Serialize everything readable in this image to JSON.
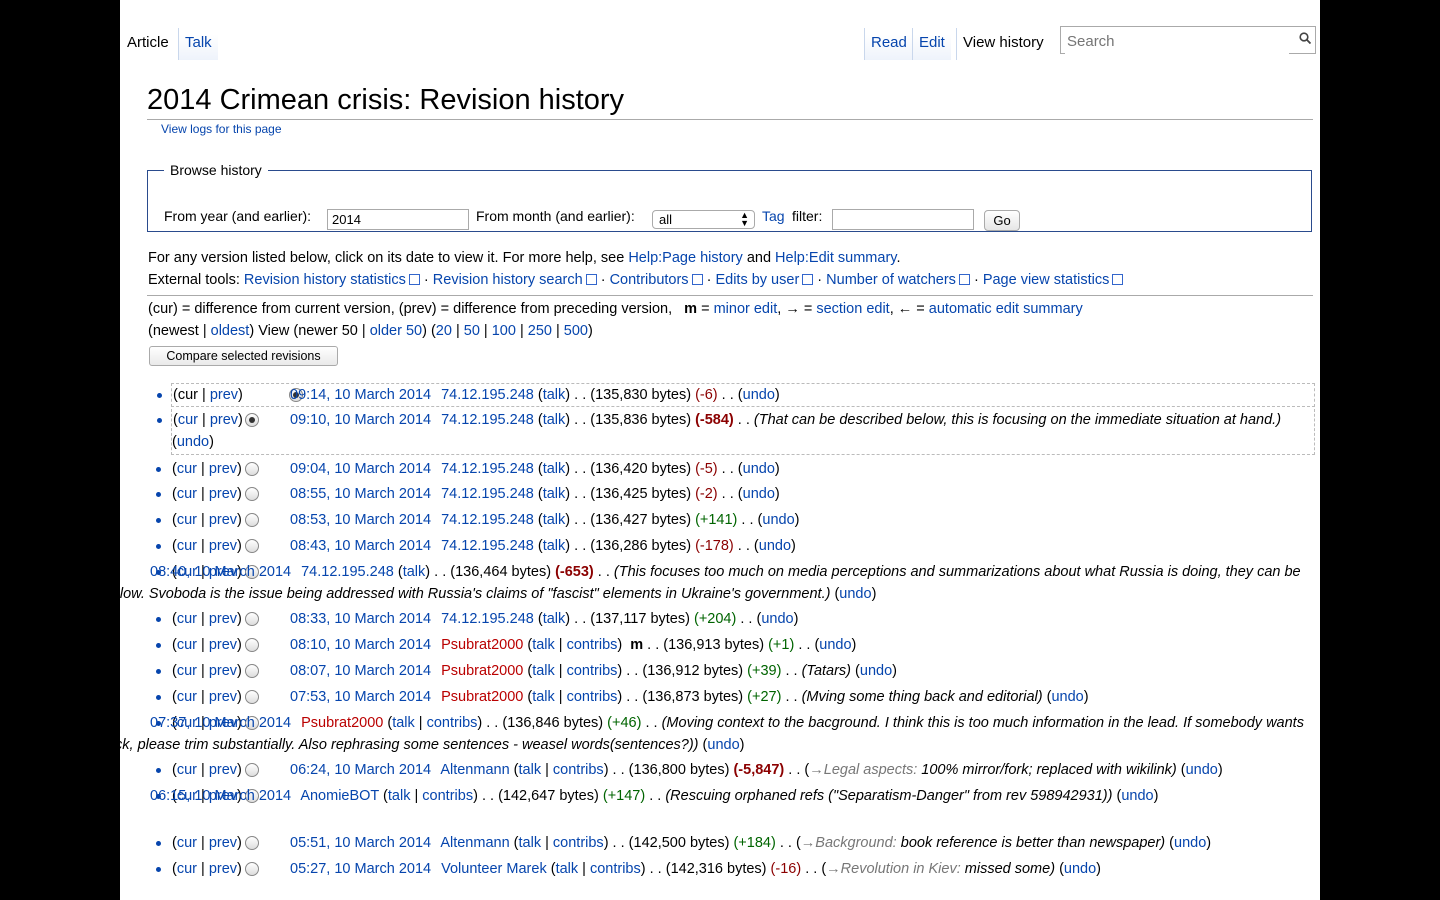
{
  "tabs": {
    "article": "Article",
    "talk": "Talk",
    "read": "Read",
    "edit": "Edit",
    "view_history": "View history"
  },
  "search": {
    "placeholder": "Search"
  },
  "title": "2014 Crimean crisis: Revision history",
  "view_logs": "View logs for this page",
  "browse": {
    "legend": "Browse history",
    "year_label": "From year (and earlier):",
    "year_value": "2014",
    "month_label": "From month (and earlier):",
    "month_value": "all",
    "tag_link": "Tag",
    "tag_label": "filter:",
    "go": "Go"
  },
  "help": {
    "prefix": "For any version listed below, click on its date to view it. For more help, see",
    "link1": "Help:Page history",
    "and": "and",
    "link2": "Help:Edit summary",
    "end": "."
  },
  "external": {
    "label": "External tools:",
    "tools": [
      "Revision history statistics",
      "Revision history search",
      "Contributors",
      "Edits by user",
      "Number of watchers",
      "Page view statistics"
    ]
  },
  "legend_line": {
    "cur": "(cur) = difference from current version, (prev) = difference from preceding version,",
    "m": "m",
    "minor": "minor edit",
    "arrow": "→",
    "eq": "=",
    "section": "section edit",
    "larrow": "←",
    "auto": "automatic edit summary"
  },
  "nav": {
    "newest": "newest",
    "oldest": "oldest",
    "view": "View (newer 50",
    "older": "older 50",
    "counts": [
      "20",
      "50",
      "100",
      "250",
      "500"
    ]
  },
  "compare_button": "Compare selected revisions",
  "revisions": [
    {
      "date": "09:14, 10 March 2014",
      "user": "74.12.195.248",
      "ip": true,
      "bytes": "(135,830 bytes)",
      "diff": "(-6)",
      "diff_class": "neg",
      "comment": "",
      "radio": "first"
    },
    {
      "date": "09:10, 10 March 2014",
      "user": "74.12.195.248",
      "ip": true,
      "bytes": "(135,836 bytes)",
      "diff": "(-584)",
      "diff_class": "negbig",
      "comment": "(That can be described below, this is focusing on the immediate situation at hand.)",
      "radio": "second"
    },
    {
      "date": "09:04, 10 March 2014",
      "user": "74.12.195.248",
      "ip": true,
      "bytes": "(136,420 bytes)",
      "diff": "(-5)",
      "diff_class": "neg",
      "comment": ""
    },
    {
      "date": "08:55, 10 March 2014",
      "user": "74.12.195.248",
      "ip": true,
      "bytes": "(136,425 bytes)",
      "diff": "(-2)",
      "diff_class": "neg",
      "comment": ""
    },
    {
      "date": "08:53, 10 March 2014",
      "user": "74.12.195.248",
      "ip": true,
      "bytes": "(136,427 bytes)",
      "diff": "(+141)",
      "diff_class": "pos",
      "comment": ""
    },
    {
      "date": "08:43, 10 March 2014",
      "user": "74.12.195.248",
      "ip": true,
      "bytes": "(136,286 bytes)",
      "diff": "(-178)",
      "diff_class": "neg",
      "comment": ""
    },
    {
      "date": "08:40, 10 March 2014",
      "user": "74.12.195.248",
      "ip": true,
      "bytes": "(136,464 bytes)",
      "diff": "(-653)",
      "diff_class": "negbig",
      "comment": "(This focuses too much on media perceptions and summarizations about what Russia is doing, they can be addressed below. Svoboda is the issue being addressed with Russia's claims of \"fascist\" elements in Ukraine's government.)"
    },
    {
      "date": "08:33, 10 March 2014",
      "user": "74.12.195.248",
      "ip": true,
      "bytes": "(137,117 bytes)",
      "diff": "(+204)",
      "diff_class": "pos",
      "comment": ""
    },
    {
      "date": "08:10, 10 March 2014",
      "user": "Psubrat2000",
      "red": true,
      "minor": true,
      "bytes": "(136,913 bytes)",
      "diff": "(+1)",
      "diff_class": "pos",
      "comment": ""
    },
    {
      "date": "08:07, 10 March 2014",
      "user": "Psubrat2000",
      "red": true,
      "bytes": "(136,912 bytes)",
      "diff": "(+39)",
      "diff_class": "pos",
      "comment": "(Tatars)"
    },
    {
      "date": "07:53, 10 March 2014",
      "user": "Psubrat2000",
      "red": true,
      "bytes": "(136,873 bytes)",
      "diff": "(+27)",
      "diff_class": "pos",
      "comment": "(Mving some thing back and editorial)"
    },
    {
      "date": "07:37, 10 March 2014",
      "user": "Psubrat2000",
      "red": true,
      "bytes": "(136,846 bytes)",
      "diff": "(+46)",
      "diff_class": "pos",
      "comment": "(Moving context to the bacground. I think this is too much information in the lead. If somebody wants to move it back, please trim substantially. Also rephrasing some sentences - weasel words(sentences?))"
    },
    {
      "date": "06:24, 10 March 2014",
      "user": "Altenmann",
      "bytes": "(136,800 bytes)",
      "diff": "(-5,847)",
      "diff_class": "negbig",
      "section": "→Legal aspects:",
      "comment": "100% mirror/fork; replaced with wikilink)"
    },
    {
      "date": "06:15, 10 March 2014",
      "user": "AnomieBOT",
      "bytes": "(142,647 bytes)",
      "diff": "(+147)",
      "diff_class": "pos",
      "comment": "(Rescuing orphaned refs (\"Separatism-Danger\" from rev 598942931))"
    },
    {
      "date": "05:51, 10 March 2014",
      "user": "Altenmann",
      "bytes": "(142,500 bytes)",
      "diff": "(+184)",
      "diff_class": "pos",
      "section": "→Background:",
      "comment": "book reference is better than newspaper)"
    },
    {
      "date": "05:27, 10 March 2014",
      "user": "Volunteer Marek",
      "bytes": "(142,316 bytes)",
      "diff": "(-16)",
      "diff_class": "neg",
      "section": "→Revolution in Kiev:",
      "comment": "missed some)"
    }
  ],
  "labels": {
    "cur": "cur",
    "prev": "prev",
    "talk": "talk",
    "contribs": "contribs",
    "undo": "undo",
    "dots": ". ."
  }
}
